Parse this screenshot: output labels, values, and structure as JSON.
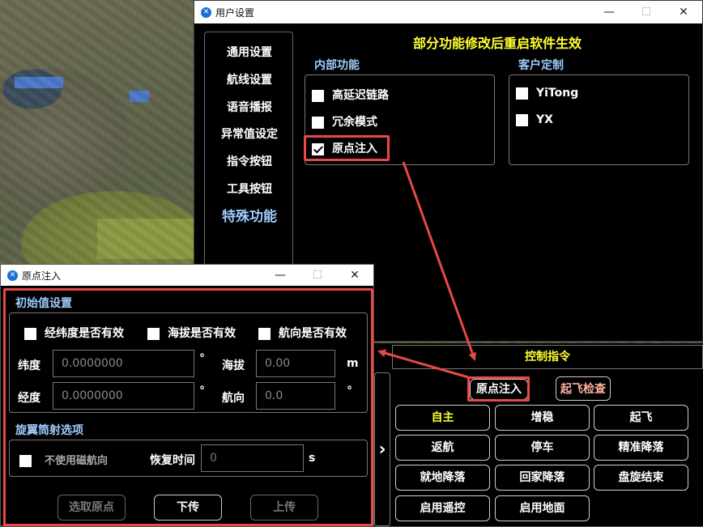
{
  "settings": {
    "title": "用户设置",
    "notice": "部分功能修改后重启软件生效",
    "nav": [
      "通用设置",
      "航线设置",
      "语音播报",
      "异常值设定",
      "指令按钮",
      "工具按钮",
      "特殊功能"
    ],
    "internal_title": "内部功能",
    "internal": [
      {
        "label": "高延迟链路",
        "checked": false
      },
      {
        "label": "冗余模式",
        "checked": false
      },
      {
        "label": "原点注入",
        "checked": true
      }
    ],
    "custom_title": "客户定制",
    "custom": [
      {
        "label": "YiTong",
        "checked": false
      },
      {
        "label": "YX",
        "checked": false
      }
    ]
  },
  "control": {
    "title": "控制指令",
    "origin": "原点注入",
    "check": "起飞检查",
    "buttons": [
      "自主",
      "增稳",
      "起飞",
      "返航",
      "停车",
      "精准降落",
      "就地降落",
      "回家降落",
      "盘旋结束",
      "启用遥控",
      "启用地面"
    ],
    "expand": "›"
  },
  "origin": {
    "title": "原点注入",
    "init_title": "初始值设置",
    "valid": [
      "经纬度是否有效",
      "海拔是否有效",
      "航向是否有效"
    ],
    "lat_label": "纬度",
    "lat_value": "0.0000000",
    "lat_unit": "°",
    "lon_label": "经度",
    "lon_value": "0.0000000",
    "lon_unit": "°",
    "alt_label": "海拔",
    "alt_value": "0.00",
    "alt_unit": "m",
    "hdg_label": "航向",
    "hdg_value": "0.0",
    "hdg_unit": "°",
    "rotor_title": "旋翼筒射选项",
    "no_mag": "不使用磁航向",
    "recover_label": "恢复时间",
    "recover_placeholder": "0",
    "recover_unit": "s",
    "btn_pick": "选取原点",
    "btn_down": "下传",
    "btn_up": "上传"
  },
  "colors": {
    "accent": "#ffff33",
    "highlight": "#e84848",
    "header": "#9ecbff"
  }
}
